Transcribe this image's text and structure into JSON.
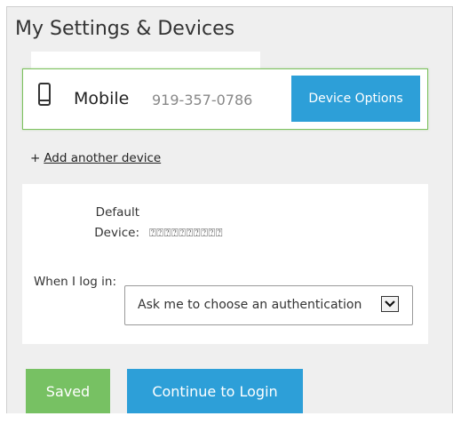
{
  "page": {
    "title": "My Settings & Devices"
  },
  "device": {
    "icon": "mobile-phone-icon",
    "type_label": "Mobile",
    "phone_number": "919-357-0786",
    "options_button_label": "Device Options"
  },
  "add_device": {
    "prefix": "+",
    "link_label": "Add another device"
  },
  "settings": {
    "default_device_label": "Default Device:",
    "default_device_value": "⍰⍰⍰⍰⍰⍰⍰⍰⍰⍰",
    "when_login_label": "When I log in:",
    "when_login_value": "Ask me to choose an authentication",
    "dropdown_icon": "chevron-down-icon"
  },
  "actions": {
    "saved_label": "Saved",
    "continue_label": "Continue to Login"
  },
  "colors": {
    "primary_blue": "#2d9fd8",
    "success_green": "#77c163",
    "card_border_green": "#7dc15f",
    "panel_background": "#efefef"
  }
}
